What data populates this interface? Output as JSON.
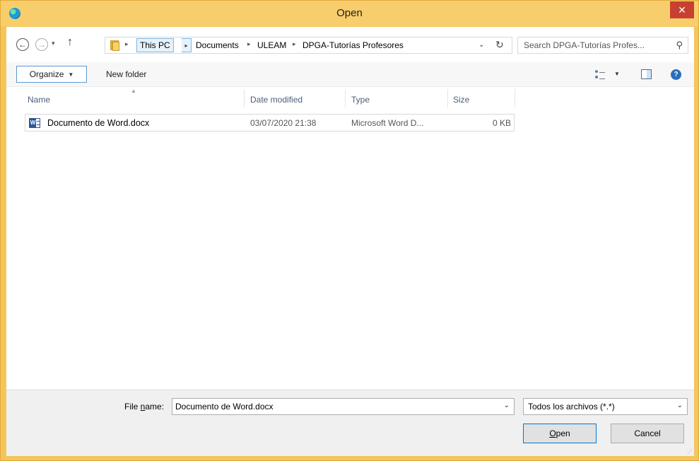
{
  "window": {
    "title": "Open",
    "close_glyph": "✕",
    "app_icon": "edge-browser-icon"
  },
  "nav": {
    "back_glyph": "←",
    "forward_glyph": "→",
    "recent_glyph": "▾",
    "up_glyph": "↑"
  },
  "address": {
    "crumbs": [
      "This PC",
      "Documents",
      "ULEAM",
      "DPGA-Tutorías Profesores"
    ],
    "separator": "▸",
    "dropdown_glyph": "⌄",
    "refresh_glyph": "↻"
  },
  "search": {
    "placeholder": "Search DPGA-Tutorías Profes...",
    "icon_glyph": "⚲"
  },
  "toolbar": {
    "organize_label": "Organize",
    "organize_caret": "▼",
    "new_folder_label": "New folder",
    "views_caret": "▼",
    "help_glyph": "?"
  },
  "columns": [
    "Name",
    "Date modified",
    "Type",
    "Size"
  ],
  "files": [
    {
      "name": "Documento de Word.docx",
      "date_modified": "03/07/2020 21:38",
      "type": "Microsoft Word D...",
      "size": "0 KB",
      "icon": "word-document-icon"
    }
  ],
  "bottom": {
    "file_name_label_pre": "File ",
    "file_name_label_u": "n",
    "file_name_label_post": "ame:",
    "file_name_value": "Documento de Word.docx",
    "filter_value": "Todos los archivos (*.*)",
    "dropdown_glyph": "⌄",
    "open_label_u": "O",
    "open_label_rest": "pen",
    "cancel_label": "Cancel"
  },
  "colors": {
    "title_bar": "#f8cd6c",
    "close_button": "#c84031",
    "selection_highlight": "#e6f2fb",
    "accent_border": "#5b9bd5"
  }
}
